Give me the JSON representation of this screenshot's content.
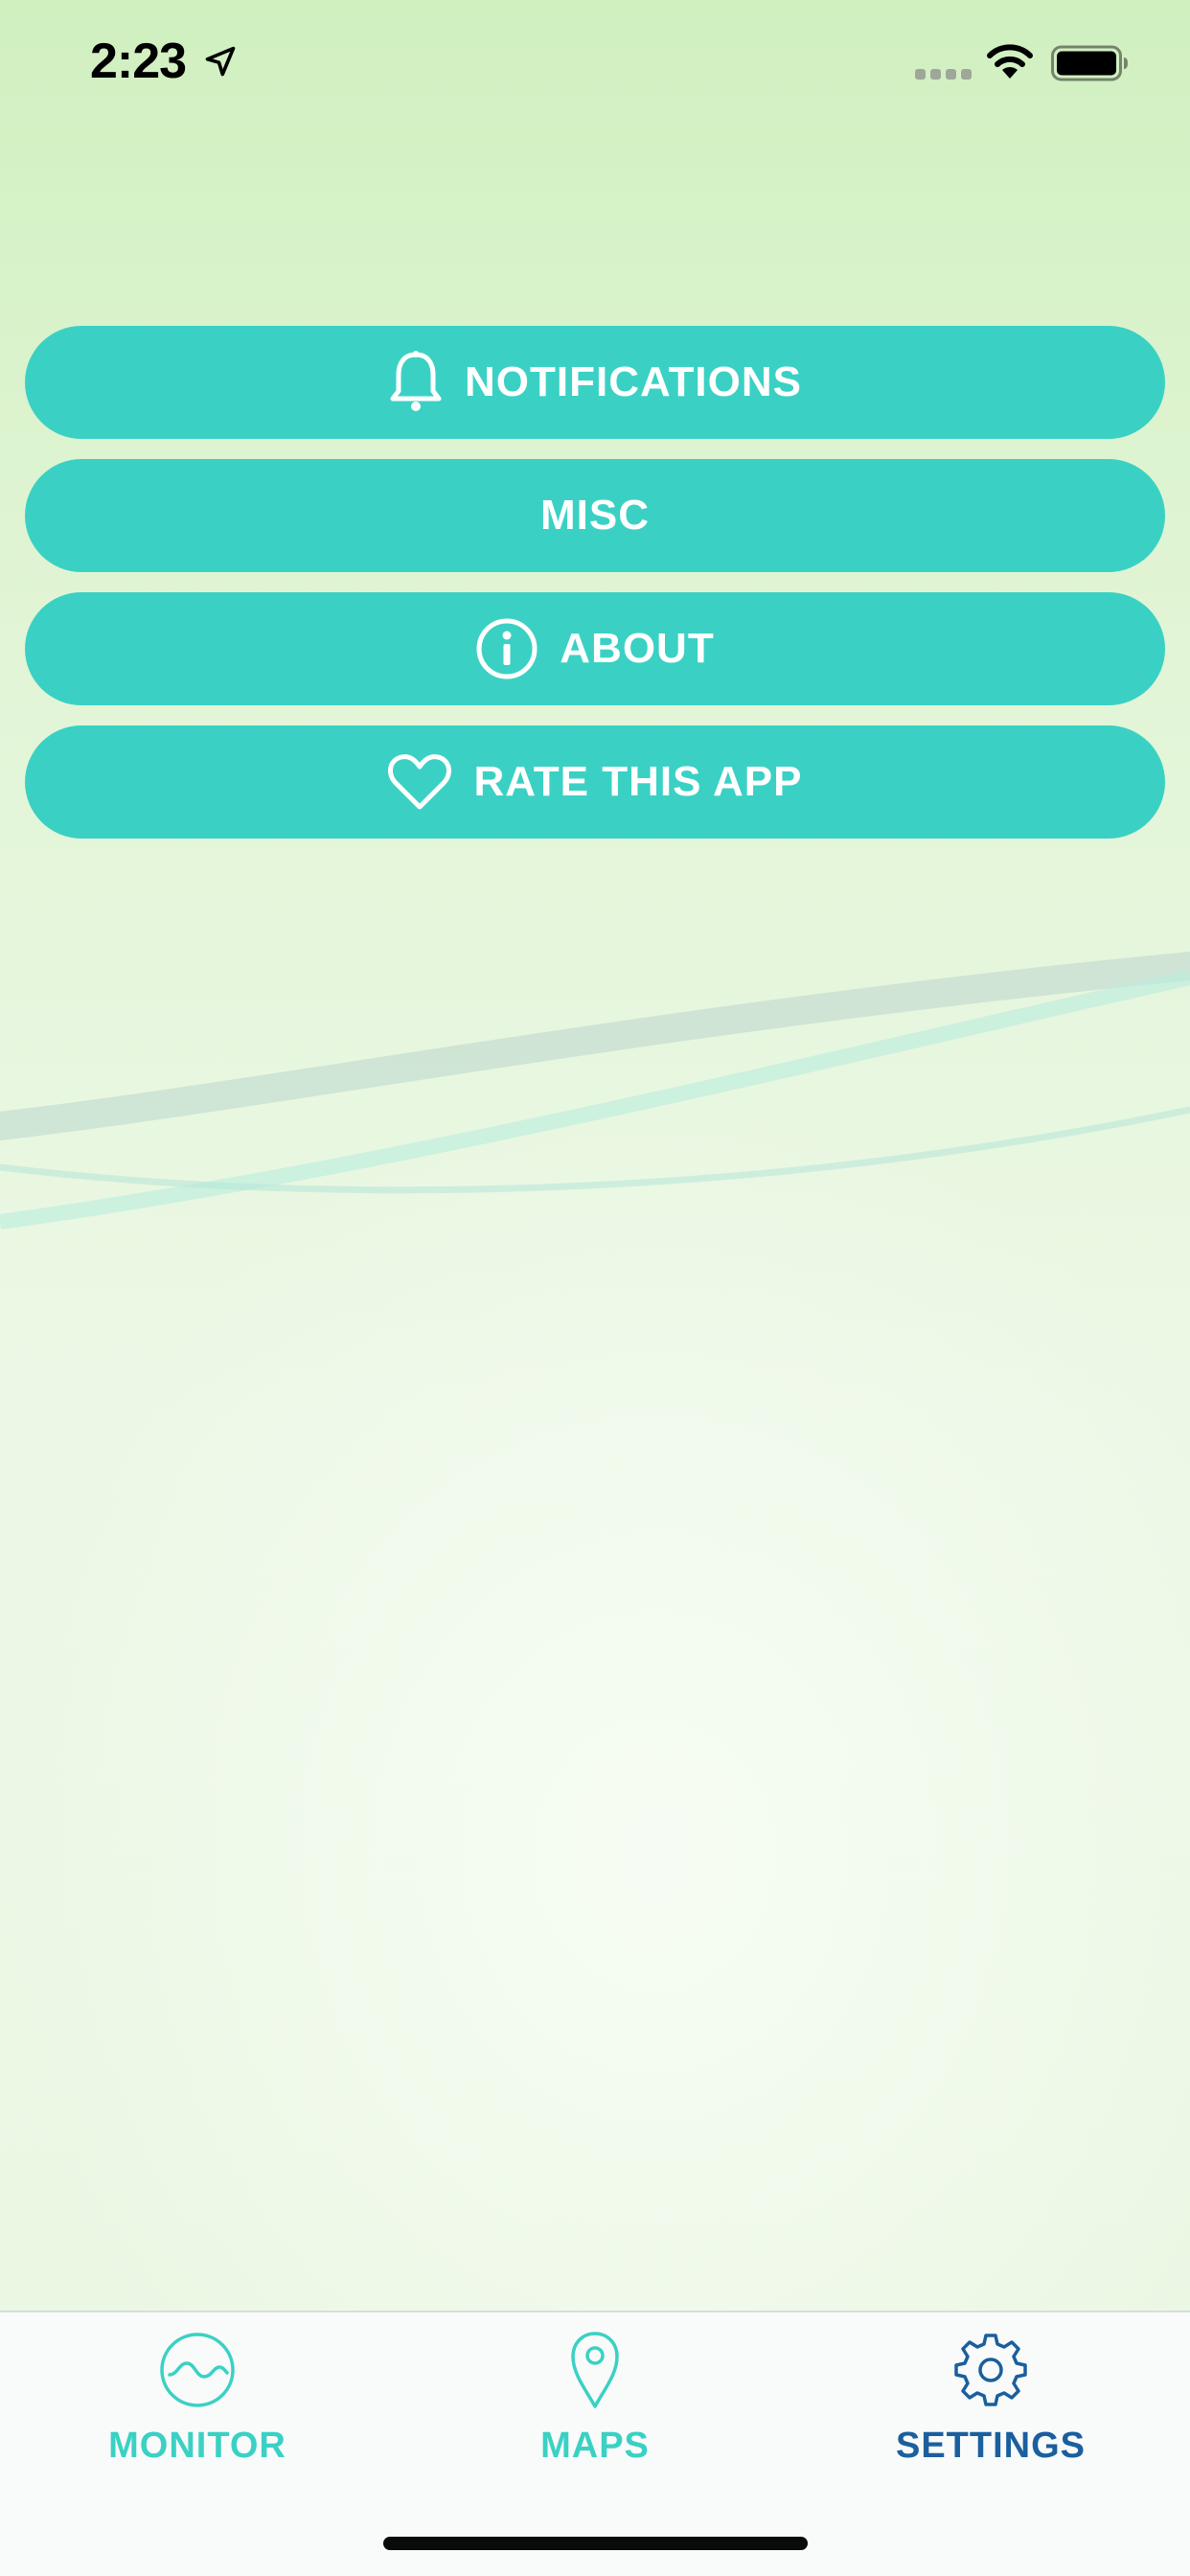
{
  "status_bar": {
    "time": "2:23"
  },
  "colors": {
    "button_bg": "#3ad1c4",
    "tab_active": "#1a5f9e",
    "tab_inactive": "#3ad1c4"
  },
  "menu": {
    "items": [
      {
        "label": "NOTIFICATIONS",
        "icon": "bell-icon"
      },
      {
        "label": "MISC",
        "icon": null
      },
      {
        "label": "ABOUT",
        "icon": "info-icon"
      },
      {
        "label": "RATE THIS APP",
        "icon": "heart-icon"
      }
    ]
  },
  "tab_bar": {
    "active": "SETTINGS",
    "tabs": [
      {
        "label": "MONITOR",
        "icon": "wave-circle-icon"
      },
      {
        "label": "MAPS",
        "icon": "map-pin-icon"
      },
      {
        "label": "SETTINGS",
        "icon": "gear-icon"
      }
    ]
  }
}
